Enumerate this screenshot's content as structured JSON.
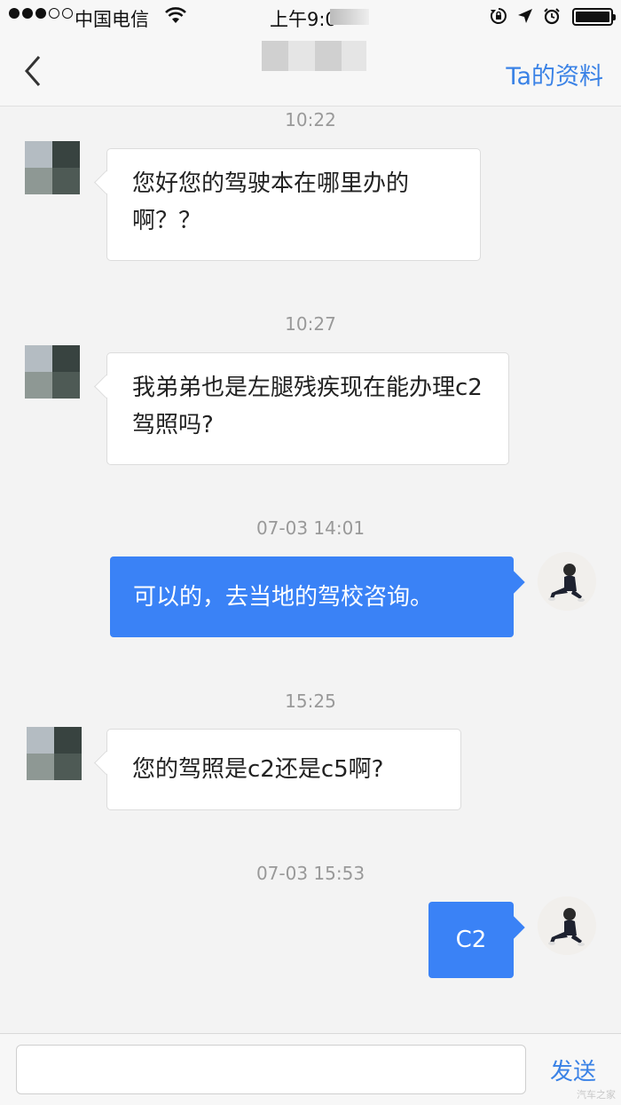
{
  "status_bar": {
    "carrier": "中国电信",
    "time": "上午9:0",
    "signal_icon": "signal-dots-icon",
    "wifi_icon": "wifi-icon",
    "icons": [
      "rotation-lock-icon",
      "location-arrow-icon",
      "alarm-icon"
    ],
    "battery_icon": "battery-full-icon"
  },
  "nav": {
    "back_icon": "chevron-left-icon",
    "right_label": "Ta的资料"
  },
  "messages": [
    {
      "timestamp": "10:22",
      "direction": "incoming",
      "text": "您好您的驾驶本在哪里办的啊？？"
    },
    {
      "timestamp": "10:27",
      "direction": "incoming",
      "text": "我弟弟也是左腿残疾现在能办理c2驾照吗?"
    },
    {
      "timestamp": "07-03 14:01",
      "direction": "outgoing",
      "text": "可以的，去当地的驾校咨询。"
    },
    {
      "timestamp": "15:25",
      "direction": "incoming",
      "text": "您的驾照是c2还是c5啊?"
    },
    {
      "timestamp": "07-03 15:53",
      "direction": "outgoing",
      "text": "C2"
    }
  ],
  "input": {
    "value": "",
    "send_label": "发送"
  },
  "watermark": "汽车之家",
  "colors": {
    "accent": "#3a82e6",
    "outgoing_bubble": "#3a82f6",
    "timestamp": "#999999"
  }
}
